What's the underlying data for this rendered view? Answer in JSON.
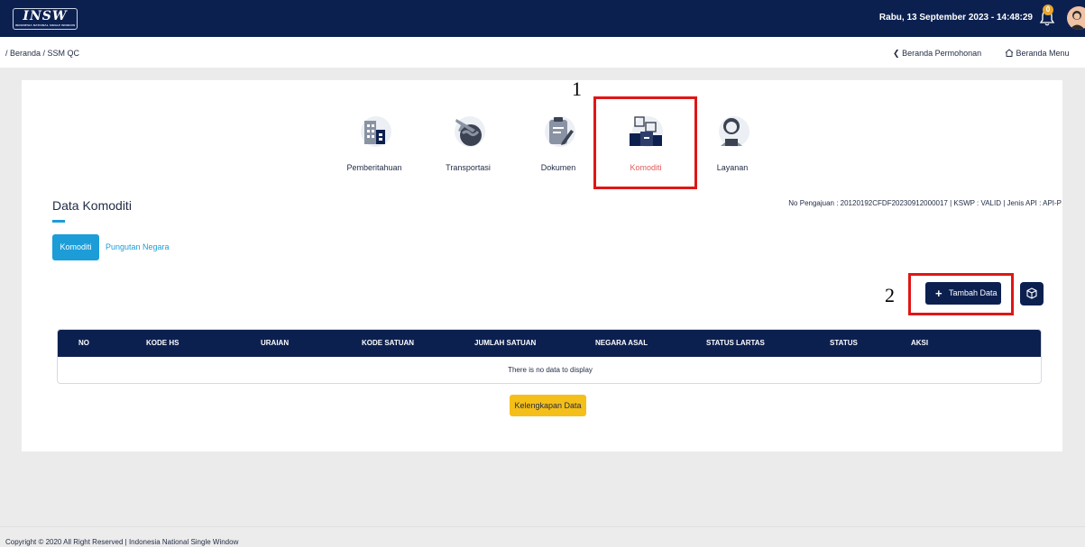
{
  "header": {
    "logo_text": "INSW",
    "logo_subtext": "INDONESIA NATIONAL SINGLE WINDOW",
    "datetime": "Rabu, 13 September 2023 - 14:48:29",
    "notification_count": "0",
    "bar_color": "#0c2050"
  },
  "breadcrumb": {
    "path": "/ Beranda / SSM QC",
    "nav_back": "Beranda Permohonan",
    "nav_home": "Beranda Menu"
  },
  "tabs": [
    {
      "label": "Pemberitahuan",
      "icon": "building-icon",
      "active": false
    },
    {
      "label": "Transportasi",
      "icon": "globe-plane-icon",
      "active": false
    },
    {
      "label": "Dokumen",
      "icon": "document-edit-icon",
      "active": false
    },
    {
      "label": "Komoditi",
      "icon": "boxes-icon",
      "active": true
    },
    {
      "label": "Layanan",
      "icon": "customer-service-icon",
      "active": false
    }
  ],
  "annotations": {
    "first": "1",
    "second": "2"
  },
  "section": {
    "title": "Data Komoditi",
    "meta": "No Pengajuan : 20120192CFDF20230912000017 | KSWP : VALID | Jenis API : API-P"
  },
  "subtabs": {
    "active": "Komoditi",
    "other": "Pungutan Negara"
  },
  "actions": {
    "add_label": "Tambah Data",
    "add_icon": "plus-icon",
    "extra_icon": "cube-icon"
  },
  "table": {
    "headers": [
      "NO",
      "KODE HS",
      "URAIAN",
      "KODE SATUAN",
      "JUMLAH SATUAN",
      "NEGARA ASAL",
      "STATUS LARTAS",
      "STATUS",
      "AKSI"
    ],
    "empty_message": "There is no data to display"
  },
  "completeness_button": "Kelengkapan Data",
  "footer": {
    "text": "Copyright © 2020 All Right Reserved |",
    "link": "Indonesia National Single Window"
  },
  "colors": {
    "accent": "#1c9dd8",
    "navy": "#0c2050",
    "active_tab_label": "#e05b5b",
    "highlight": "#e01616",
    "button_yellow": "#f5bf1a"
  }
}
